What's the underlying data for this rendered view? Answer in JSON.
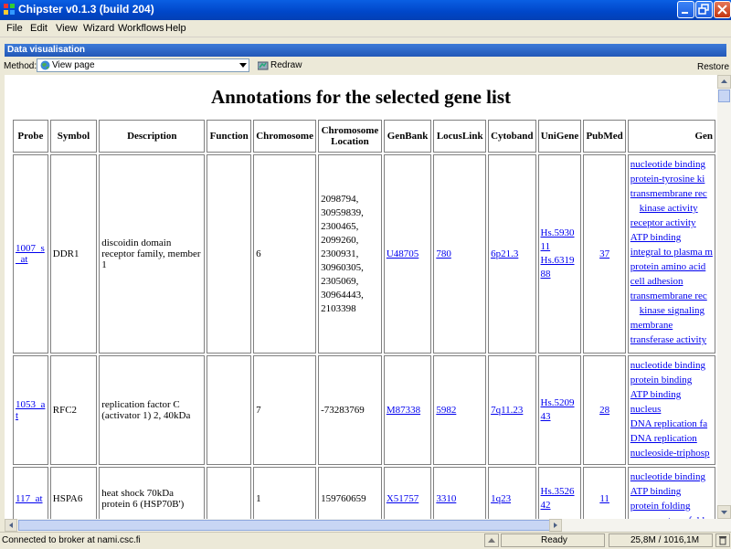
{
  "window": {
    "title": "Chipster v0.1.3 (build 204)"
  },
  "menu": [
    "File",
    "Edit",
    "View",
    "Wizard",
    "Workflows",
    "Help"
  ],
  "panel": {
    "title": "Data visualisation"
  },
  "toolbar": {
    "method_label": "Method:",
    "method_value": "View page",
    "redraw_label": "Redraw",
    "restore_label": "Restore"
  },
  "page": {
    "heading": "Annotations for the selected gene list"
  },
  "table": {
    "headers": [
      "Probe",
      "Symbol",
      "Description",
      "Function",
      "Chromosome",
      "Chromosome Location",
      "GenBank",
      "LocusLink",
      "Cytoband",
      "UniGene",
      "PubMed",
      "Gen"
    ],
    "rows": [
      {
        "probe": "1007_s_at",
        "symbol": "DDR1",
        "description": "discoidin domain receptor family, member 1",
        "function": "",
        "chromosome": "6",
        "location": [
          "2098794,",
          "30959839,",
          "2300465,",
          "2099260,",
          "2300931,",
          "30960305,",
          "2305069,",
          "30964443,",
          "2103398"
        ],
        "genbank": "U48705",
        "locuslink": "780",
        "cytoband": "6p21.3",
        "unigene": [
          "Hs.5930",
          "11",
          "Hs.6319",
          "88"
        ],
        "pubmed": "37",
        "go": [
          {
            "t": "nucleotide binding",
            "i": false
          },
          {
            "t": "protein-tyrosine ki",
            "i": false
          },
          {
            "t": "transmembrane rec",
            "i": false
          },
          {
            "t": "kinase activity",
            "i": true
          },
          {
            "t": "receptor activity",
            "i": false
          },
          {
            "t": "ATP binding",
            "i": false
          },
          {
            "t": "integral to plasma m",
            "i": false
          },
          {
            "t": "protein amino acid",
            "i": false
          },
          {
            "t": "cell adhesion",
            "i": false
          },
          {
            "t": "transmembrane rec",
            "i": false
          },
          {
            "t": "kinase signaling",
            "i": true
          },
          {
            "t": "membrane",
            "i": false
          },
          {
            "t": "transferase activity",
            "i": false
          }
        ]
      },
      {
        "probe": "1053_at",
        "symbol": "RFC2",
        "description": "replication factor C (activator 1) 2, 40kDa",
        "function": "",
        "chromosome": "7",
        "location": [
          "-73283769"
        ],
        "genbank": "M87338",
        "locuslink": "5982",
        "cytoband": "7q11.23",
        "unigene": [
          "Hs.5209",
          "43"
        ],
        "pubmed": "28",
        "go": [
          {
            "t": "nucleotide binding",
            "i": false
          },
          {
            "t": "protein binding",
            "i": false
          },
          {
            "t": "ATP binding",
            "i": false
          },
          {
            "t": "nucleus",
            "i": false
          },
          {
            "t": "DNA replication fa",
            "i": false
          },
          {
            "t": "DNA replication",
            "i": false
          },
          {
            "t": "nucleoside-triphosp",
            "i": false
          }
        ]
      },
      {
        "probe": "117_at",
        "symbol": "HSPA6",
        "description": "heat shock 70kDa protein 6 (HSP70B')",
        "function": "",
        "chromosome": "1",
        "location": [
          "159760659"
        ],
        "genbank": "X51757",
        "locuslink": "3310",
        "cytoband": "1q23",
        "unigene": [
          "Hs.3526",
          "42"
        ],
        "pubmed": "11",
        "go": [
          {
            "t": "nucleotide binding",
            "i": false
          },
          {
            "t": "ATP binding",
            "i": false
          },
          {
            "t": "protein folding",
            "i": false
          },
          {
            "t": "response to unfold",
            "i": false
          }
        ]
      }
    ]
  },
  "status": {
    "connection": "Connected to broker at nami.csc.fi",
    "state": "Ready",
    "memory": "25,8M / 1016,1M"
  }
}
